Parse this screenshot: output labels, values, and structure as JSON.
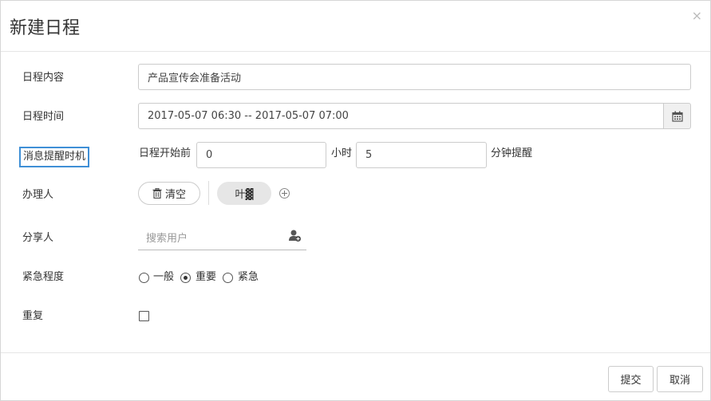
{
  "dialog": {
    "title": "新建日程",
    "close_glyph": "×"
  },
  "form": {
    "content": {
      "label": "日程内容",
      "value": "产品宣传会准备活动"
    },
    "time": {
      "label": "日程时间",
      "value": "2017-05-07 06:30 -- 2017-05-07 07:00",
      "icon": "calendar-icon"
    },
    "reminder": {
      "label": "消息提醒时机",
      "prefix": "日程开始前",
      "hours_value": "0",
      "hours_unit": "小时",
      "minutes_value": "5",
      "minutes_suffix": "分钟提醒"
    },
    "assignee": {
      "label": "办理人",
      "clear_label": "清空",
      "user_name": "叶▓",
      "clear_icon": "trash-icon",
      "add_icon": "plus-circle-icon"
    },
    "share": {
      "label": "分享人",
      "search_placeholder": "搜索用户",
      "icon": "user-add-icon"
    },
    "urgency": {
      "label": "紧急程度",
      "options": [
        "一般",
        "重要",
        "紧急"
      ],
      "selected": "重要"
    },
    "repeat": {
      "label": "重复",
      "checked": false
    }
  },
  "footer": {
    "submit_label": "提交",
    "cancel_label": "取消"
  },
  "colors": {
    "highlight_border": "#3f8fd6",
    "border": "#cccccc",
    "addon_bg": "#f0f0f0",
    "user_pill_bg": "#e6e6e6"
  }
}
